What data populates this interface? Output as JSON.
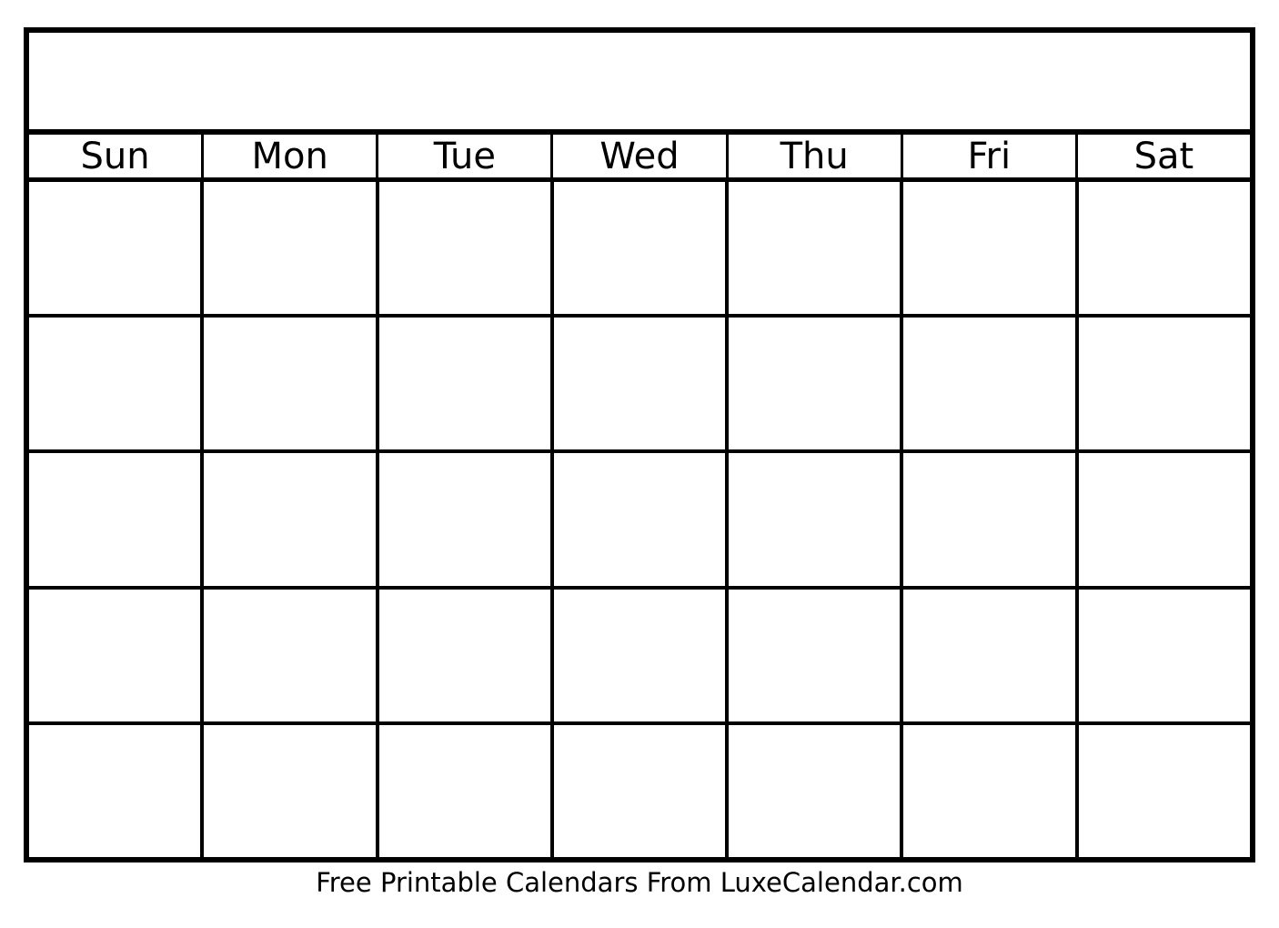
{
  "document": {
    "type": "blank-monthly-calendar-template",
    "background_color": "#ffffff",
    "line_color": "#000000",
    "text_color": "#000000"
  },
  "calendar": {
    "title": "",
    "weekday_headers": [
      {
        "label": "Sun"
      },
      {
        "label": "Mon"
      },
      {
        "label": "Tue"
      },
      {
        "label": "Wed"
      },
      {
        "label": "Thu"
      },
      {
        "label": "Fri"
      },
      {
        "label": "Sat"
      }
    ],
    "weeks": [
      {
        "days": [
          {
            "number": ""
          },
          {
            "number": ""
          },
          {
            "number": ""
          },
          {
            "number": ""
          },
          {
            "number": ""
          },
          {
            "number": ""
          },
          {
            "number": ""
          }
        ]
      },
      {
        "days": [
          {
            "number": ""
          },
          {
            "number": ""
          },
          {
            "number": ""
          },
          {
            "number": ""
          },
          {
            "number": ""
          },
          {
            "number": ""
          },
          {
            "number": ""
          }
        ]
      },
      {
        "days": [
          {
            "number": ""
          },
          {
            "number": ""
          },
          {
            "number": ""
          },
          {
            "number": ""
          },
          {
            "number": ""
          },
          {
            "number": ""
          },
          {
            "number": ""
          }
        ]
      },
      {
        "days": [
          {
            "number": ""
          },
          {
            "number": ""
          },
          {
            "number": ""
          },
          {
            "number": ""
          },
          {
            "number": ""
          },
          {
            "number": ""
          },
          {
            "number": ""
          }
        ]
      },
      {
        "days": [
          {
            "number": ""
          },
          {
            "number": ""
          },
          {
            "number": ""
          },
          {
            "number": ""
          },
          {
            "number": ""
          },
          {
            "number": ""
          },
          {
            "number": ""
          }
        ]
      }
    ]
  },
  "footer": {
    "credit_text": "Free Printable Calendars From LuxeCalendar.com"
  }
}
